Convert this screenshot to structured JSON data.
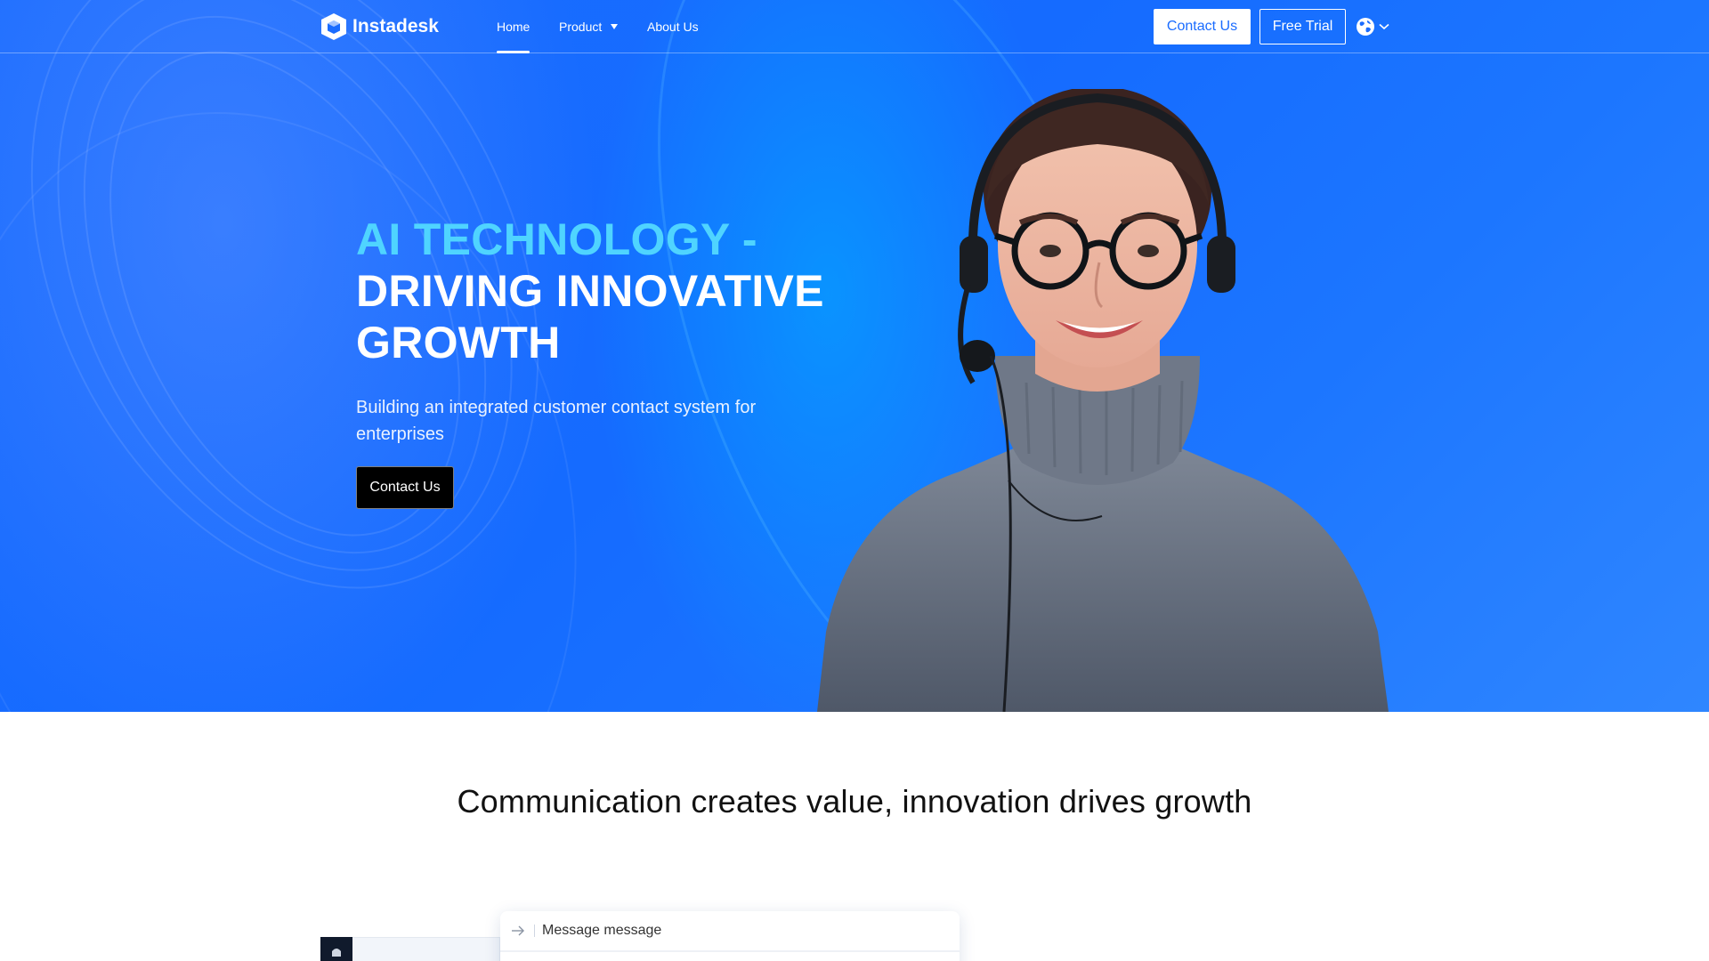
{
  "brand": {
    "name": "Instadesk"
  },
  "nav": {
    "links": [
      {
        "label": "Home",
        "active": true
      },
      {
        "label": "Product",
        "has_dropdown": true
      },
      {
        "label": "About Us"
      }
    ],
    "contact_label": "Contact Us",
    "trial_label": "Free Trial",
    "language_icon": "globe-icon"
  },
  "hero": {
    "title_accent": "AI TECHNOLOGY -",
    "title_line2": "DRIVING INNOVATIVE",
    "title_line3": "GROWTH",
    "subtitle": "Building an integrated customer contact system for enterprises",
    "cta_label": "Contact Us"
  },
  "section2": {
    "tagline": "Communication creates value, innovation drives growth",
    "message_placeholder": "Message message"
  },
  "colors": {
    "primary": "#1a6cff",
    "accent_cyan": "#4fd4ff",
    "dark": "#000000"
  }
}
